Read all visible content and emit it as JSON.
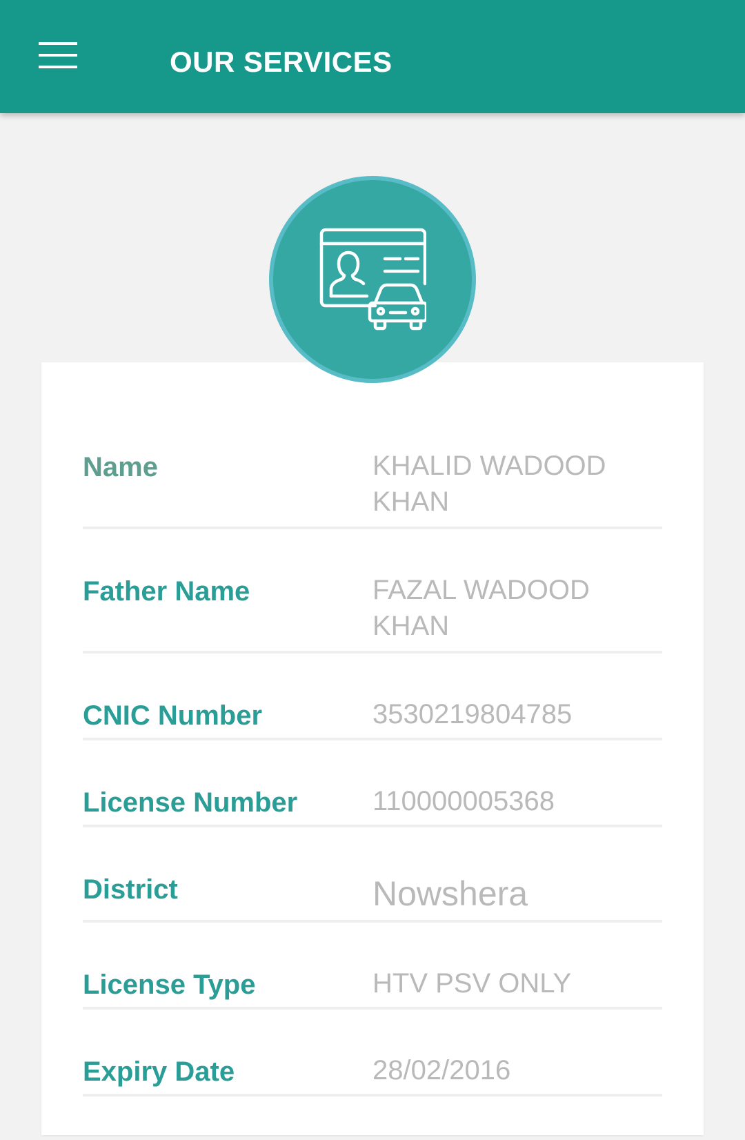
{
  "app_bar": {
    "title": "OUR SERVICES",
    "menu_icon": "hamburger-menu-icon",
    "background": "#16998a"
  },
  "header_icon": "driving-license-icon",
  "fields": [
    {
      "label": "Name",
      "value": "KHALID WADOOD KHAN"
    },
    {
      "label": "Father Name",
      "value": "FAZAL WADOOD KHAN"
    },
    {
      "label": "CNIC Number",
      "value": "3530219804785"
    },
    {
      "label": "License Number",
      "value": "110000005368"
    },
    {
      "label": "District",
      "value": "Nowshera"
    },
    {
      "label": "License Type",
      "value": "HTV PSV ONLY"
    },
    {
      "label": "Expiry Date",
      "value": "28/02/2016"
    }
  ],
  "colors": {
    "accent": "#2a9d97",
    "value_text": "#b9b9b9",
    "badge": "#36a8a3"
  }
}
